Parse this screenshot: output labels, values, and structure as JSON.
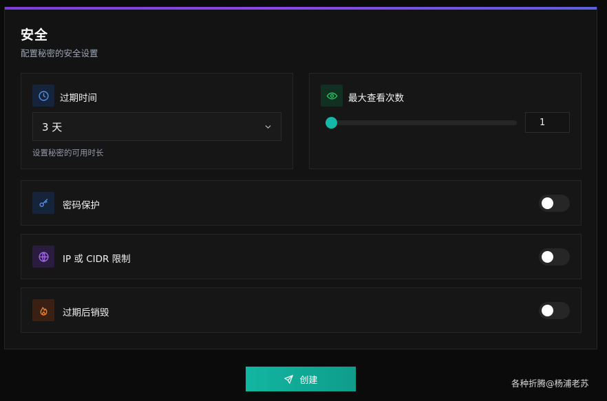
{
  "header": {
    "title": "安全",
    "subtitle": "配置秘密的安全设置"
  },
  "expiry": {
    "label": "过期时间",
    "icon": "clock-icon",
    "selected": "3 天",
    "hint": "设置秘密的可用时长"
  },
  "max_views": {
    "label": "最大查看次数",
    "icon": "eye-icon",
    "value": "1",
    "slider_fraction": 0.0
  },
  "toggles": [
    {
      "label": "密码保护",
      "icon": "key-icon",
      "enabled": false
    },
    {
      "label": "IP 或 CIDR 限制",
      "icon": "globe-icon",
      "enabled": false
    },
    {
      "label": "过期后销毁",
      "icon": "flame-icon",
      "enabled": false
    }
  ],
  "actions": {
    "create_label": "创建",
    "create_icon": "send-icon"
  },
  "watermark": "各种折腾@杨浦老苏",
  "colors": {
    "accent": "#14b8a6",
    "top_bar_start": "#7b3fd8",
    "top_bar_end": "#5b5fe0",
    "blue_icon": "#4f8fe6",
    "green_icon": "#22c55e",
    "purple_icon": "#a266e8",
    "orange_icon": "#f07a2a"
  }
}
